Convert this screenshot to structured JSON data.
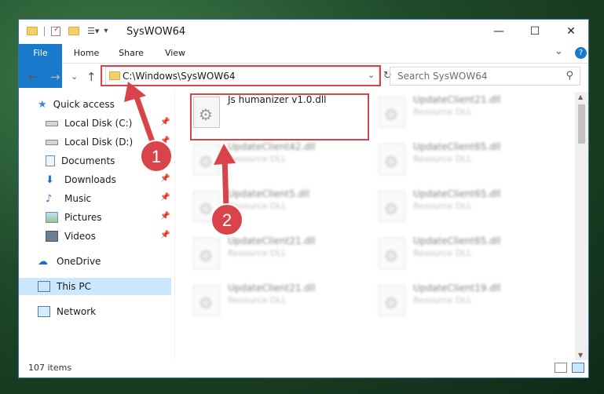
{
  "window": {
    "title": "SysWOW64",
    "minimize_glyph": "—",
    "maximize_glyph": "☐",
    "close_glyph": "✕",
    "help_glyph": "?"
  },
  "ribbon": {
    "tabs": [
      "File",
      "Home",
      "Share",
      "View"
    ],
    "collapse_glyph": "⌄"
  },
  "nav": {
    "back_glyph": "←",
    "forward_glyph": "→",
    "recent_glyph": "⌄",
    "up_glyph": "↑",
    "address": "C:\\Windows\\SysWOW64",
    "address_dropdown_glyph": "⌄",
    "refresh_glyph": "↻",
    "search_placeholder": "Search SysWOW64",
    "search_glyph": "⚲"
  },
  "sidebar": {
    "items": [
      {
        "label": "Quick access",
        "icon": "star-icon",
        "pinned": false
      },
      {
        "label": "Local Disk (C:)",
        "icon": "drive-icon",
        "pinned": true
      },
      {
        "label": "Local Disk (D:)",
        "icon": "drive-icon",
        "pinned": true
      },
      {
        "label": "Documents",
        "icon": "documents-icon",
        "pinned": true
      },
      {
        "label": "Downloads",
        "icon": "downloads-icon",
        "pinned": true
      },
      {
        "label": "Music",
        "icon": "music-icon",
        "pinned": true
      },
      {
        "label": "Pictures",
        "icon": "pictures-icon",
        "pinned": true
      },
      {
        "label": "Videos",
        "icon": "videos-icon",
        "pinned": true
      },
      {
        "label": "OneDrive",
        "icon": "cloud-icon",
        "pinned": false
      },
      {
        "label": "This PC",
        "icon": "computer-icon",
        "pinned": false
      },
      {
        "label": "Network",
        "icon": "network-icon",
        "pinned": false
      }
    ],
    "pin_glyph": "📌"
  },
  "files": [
    {
      "name": "Js humanizer v1.0.dll",
      "type": ""
    },
    {
      "name": "UpdateClient21.dll",
      "type": "Resource DLL"
    },
    {
      "name": "UpdateClient42.dll",
      "type": "Resource DLL"
    },
    {
      "name": "UpdateClient65.dll",
      "type": "Resource DLL"
    },
    {
      "name": "UpdateClient5.dll",
      "type": "Resource DLL"
    },
    {
      "name": "UpdateClient65.dll",
      "type": "Resource DLL"
    },
    {
      "name": "UpdateClient21.dll",
      "type": "Resource DLL"
    },
    {
      "name": "UpdateClient65.dll",
      "type": "Resource DLL"
    },
    {
      "name": "UpdateClient21.dll",
      "type": "Resource DLL"
    },
    {
      "name": "UpdateClient19.dll",
      "type": "Resource DLL"
    }
  ],
  "annotations": {
    "step1": "1",
    "step2": "2",
    "color": "#d9444a"
  },
  "status": {
    "item_count": "107 items"
  },
  "colors": {
    "accent": "#1979ca",
    "selection": "#cce8ff"
  }
}
